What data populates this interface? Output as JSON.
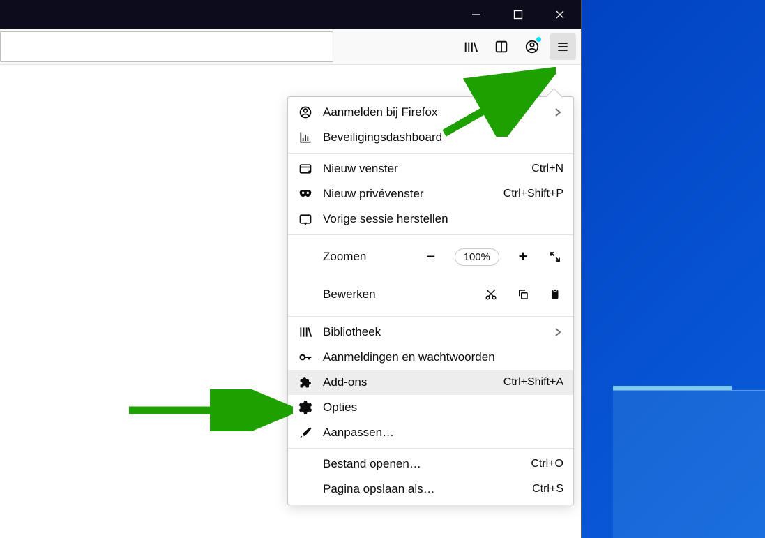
{
  "titlebar": {
    "minimize": "—",
    "maximize": "□",
    "close": "✕"
  },
  "toolbar": {
    "library": "library",
    "reader": "reader",
    "account": "account",
    "hamburger": "menu"
  },
  "menu": {
    "signin": "Aanmelden bij Firefox",
    "security_dashboard": "Beveiligingsdashboard",
    "new_window": {
      "label": "Nieuw venster",
      "shortcut": "Ctrl+N"
    },
    "new_private": {
      "label": "Nieuw privévenster",
      "shortcut": "Ctrl+Shift+P"
    },
    "restore_session": "Vorige sessie herstellen",
    "zoom": {
      "label": "Zoomen",
      "percent": "100%"
    },
    "edit": {
      "label": "Bewerken"
    },
    "library": "Bibliotheek",
    "logins": "Aanmeldingen en wachtwoorden",
    "addons": {
      "label": "Add-ons",
      "shortcut": "Ctrl+Shift+A"
    },
    "options": "Opties",
    "customize": "Aanpassen…",
    "open_file": {
      "label": "Bestand openen…",
      "shortcut": "Ctrl+O"
    },
    "save_page": {
      "label": "Pagina opslaan als…",
      "shortcut": "Ctrl+S"
    }
  }
}
